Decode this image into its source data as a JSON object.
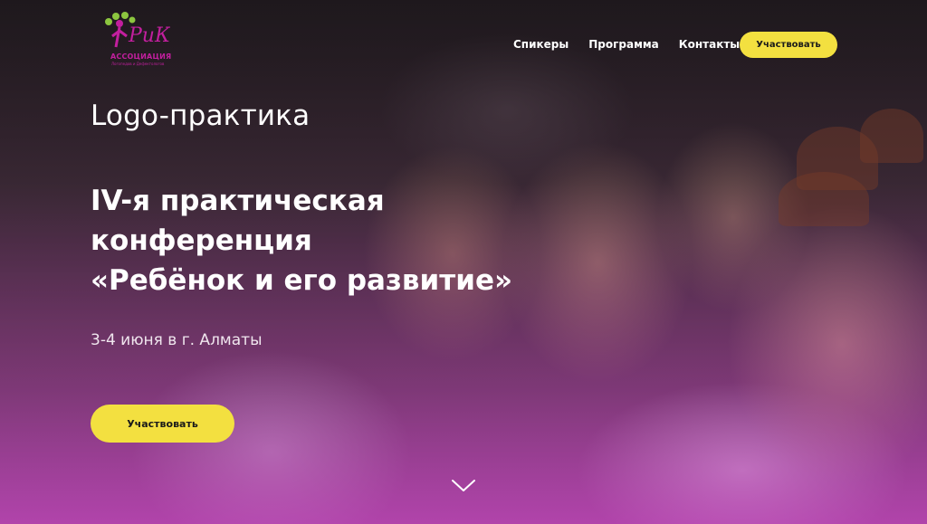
{
  "logo": {
    "mark_text": "РиК",
    "title": "АССОЦИАЦИЯ",
    "subtitle": "Логопедов и Дефектологов"
  },
  "nav": {
    "items": [
      {
        "label": "Спикеры"
      },
      {
        "label": "Программа"
      },
      {
        "label": "Контакты"
      }
    ],
    "cta_label": "Участвовать"
  },
  "hero": {
    "brand": "Logo-практика",
    "title_lines": [
      "IV-я практическая",
      "конференция",
      "«Ребёнок и его развитие»"
    ],
    "date": "3-4 июня в г. Алматы",
    "cta_label": "Участвовать"
  },
  "colors": {
    "accent": "#f3e040",
    "brand_magenta": "#c21f9e",
    "text": "#ffffff"
  },
  "icons": {
    "scroll": "chevron-down-icon"
  }
}
